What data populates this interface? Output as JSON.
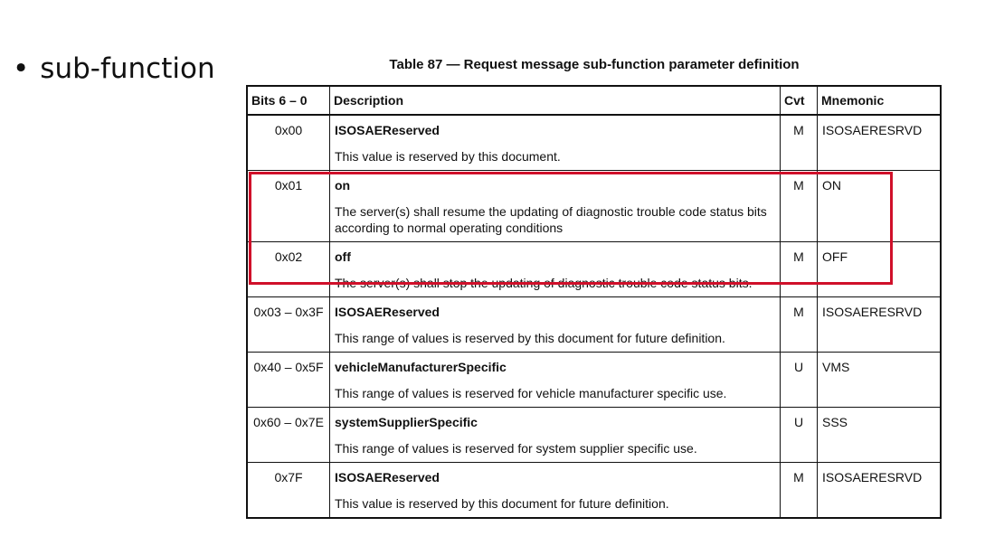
{
  "bullet": {
    "symbol": "•",
    "text": "sub-function"
  },
  "table": {
    "caption": "Table 87 — Request message sub-function parameter definition",
    "headers": {
      "bits": "Bits 6 – 0",
      "description": "Description",
      "cvt": "Cvt",
      "mnemonic": "Mnemonic"
    },
    "rows": [
      {
        "bits": "0x00",
        "name": "ISOSAEReserved",
        "text": "This value is reserved by this document.",
        "cvt": "M",
        "mnemonic": "ISOSAERESRVD"
      },
      {
        "bits": "0x01",
        "name": "on",
        "text": "The server(s) shall resume the updating of diagnostic trouble code status bits according to normal operating conditions",
        "cvt": "M",
        "mnemonic": "ON"
      },
      {
        "bits": "0x02",
        "name": "off",
        "text": "The server(s) shall stop the updating of diagnostic trouble code status bits.",
        "cvt": "M",
        "mnemonic": "OFF"
      },
      {
        "bits": "0x03 – 0x3F",
        "name": "ISOSAEReserved",
        "text": "This range of values is reserved by this document for future definition.",
        "cvt": "M",
        "mnemonic": "ISOSAERESRVD"
      },
      {
        "bits": "0x40 – 0x5F",
        "name": "vehicleManufacturerSpecific",
        "text": "This range of values is reserved for vehicle manufacturer specific use.",
        "cvt": "U",
        "mnemonic": "VMS"
      },
      {
        "bits": "0x60 – 0x7E",
        "name": "systemSupplierSpecific",
        "text": "This range of values is reserved for system supplier specific use.",
        "cvt": "U",
        "mnemonic": "SSS"
      },
      {
        "bits": "0x7F",
        "name": "ISOSAEReserved",
        "text": "This value is reserved by this document for future definition.",
        "cvt": "M",
        "mnemonic": "ISOSAERESRVD"
      }
    ]
  },
  "highlight": {
    "color": "#d0102a"
  }
}
